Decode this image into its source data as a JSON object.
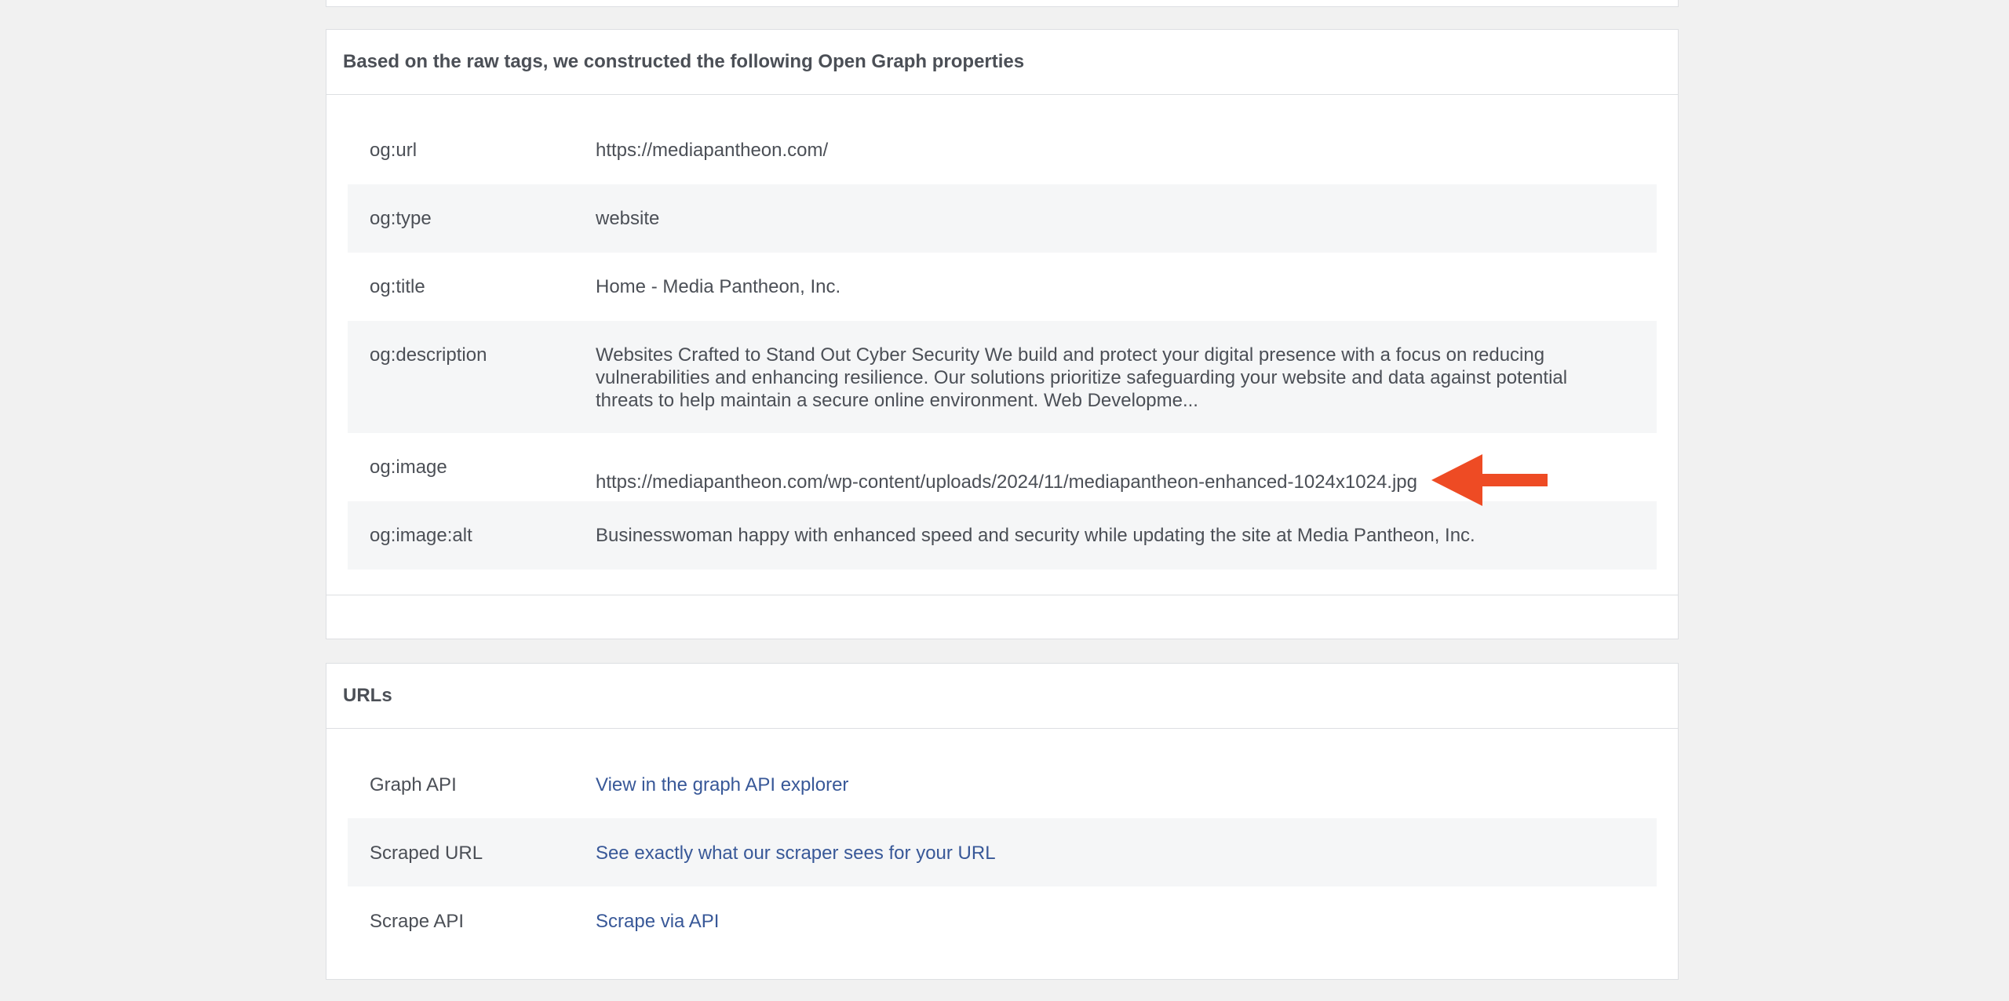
{
  "og_section": {
    "title": "Based on the raw tags, we constructed the following Open Graph properties",
    "rows": [
      {
        "key": "og:url",
        "value": "https://mediapantheon.com/"
      },
      {
        "key": "og:type",
        "value": "website"
      },
      {
        "key": "og:title",
        "value": "Home - Media Pantheon, Inc."
      },
      {
        "key": "og:description",
        "value": "Websites Crafted to Stand Out Cyber Security We build and protect your digital presence with a focus on reducing vulnerabilities and enhancing resilience. Our solutions prioritize safeguarding your website and data against potential threats to help maintain a secure online environment. Web Developme..."
      },
      {
        "key": "og:image",
        "value": "https://mediapantheon.com/wp-content/uploads/2024/11/mediapantheon-enhanced-1024x1024.jpg"
      },
      {
        "key": "og:image:alt",
        "value": "Businesswoman happy with enhanced speed and security while updating the site at Media Pantheon, Inc."
      }
    ]
  },
  "urls_section": {
    "title": "URLs",
    "rows": [
      {
        "key": "Graph API",
        "value": "View in the graph API explorer"
      },
      {
        "key": "Scraped URL",
        "value": "See exactly what our scraper sees for your URL"
      },
      {
        "key": "Scrape API",
        "value": "Scrape via API"
      }
    ]
  },
  "annotation": {
    "arrow_icon": "left-arrow-icon",
    "arrow_color": "#ee4b24"
  },
  "colors": {
    "page_bg": "#f1f1f1",
    "panel_border": "#dddfe2",
    "alt_row_bg": "#f5f6f7",
    "text": "#4b4f56",
    "link": "#385898"
  }
}
